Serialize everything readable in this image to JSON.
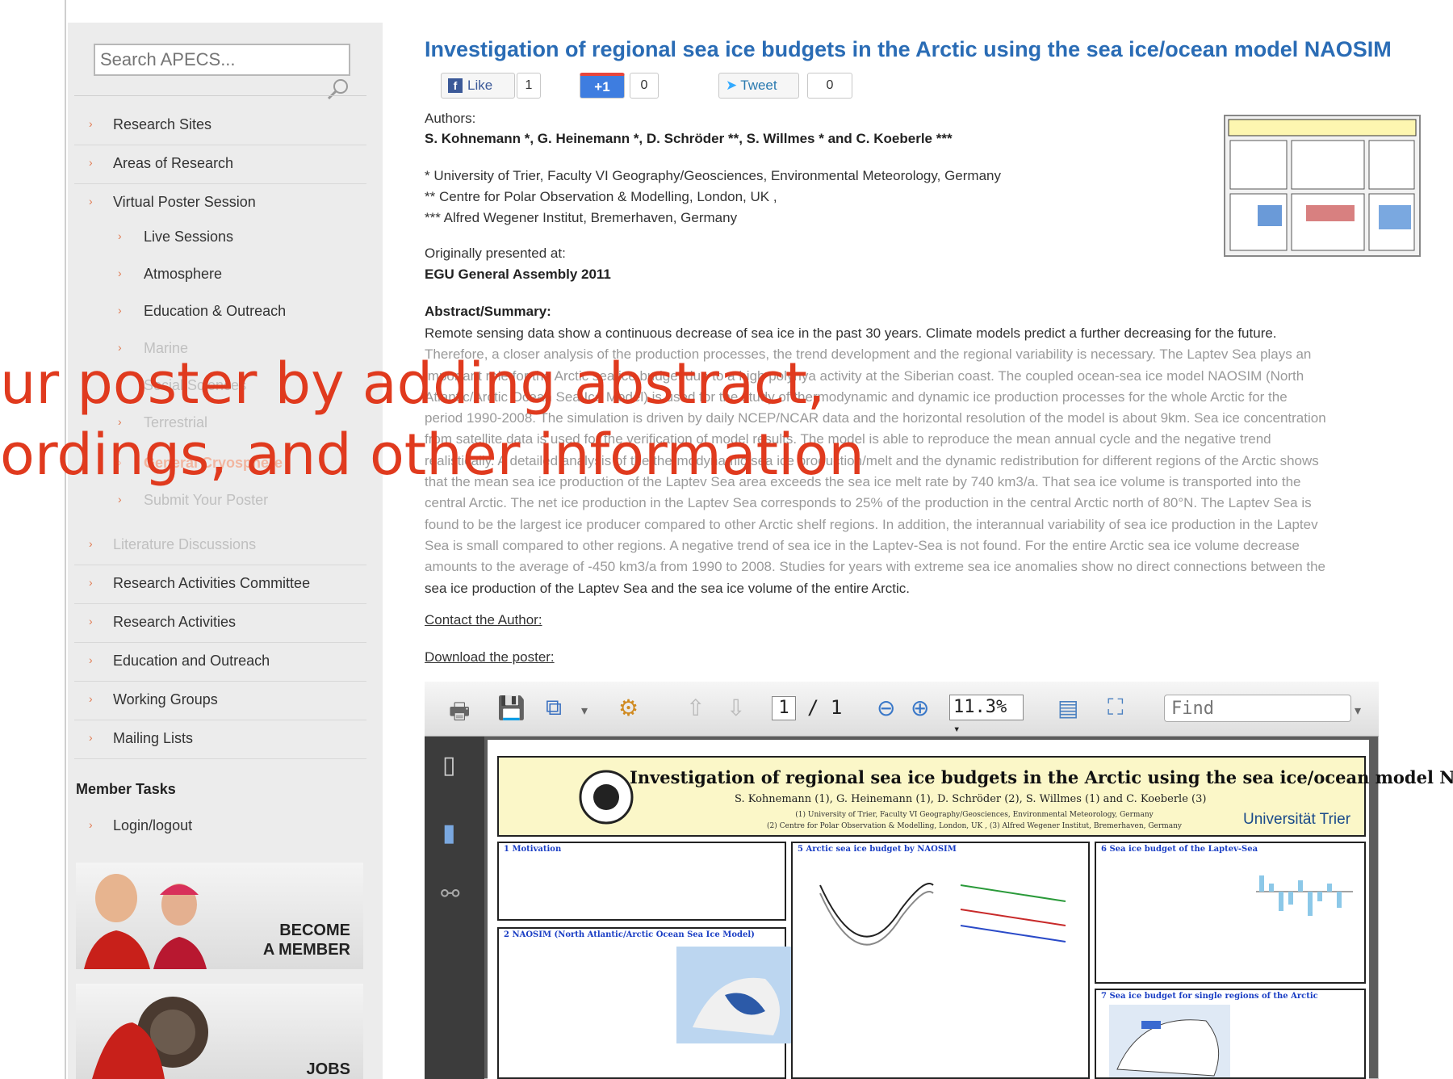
{
  "search": {
    "placeholder": "Search APECS..."
  },
  "sidebar": {
    "items": [
      {
        "label": "Research Sites"
      },
      {
        "label": "Areas of Research"
      },
      {
        "label": "Virtual Poster Session"
      }
    ],
    "subitems": [
      {
        "label": "Live Sessions"
      },
      {
        "label": "Atmosphere"
      },
      {
        "label": "Education & Outreach"
      },
      {
        "label": "Marine"
      },
      {
        "label": "Social Sciences"
      },
      {
        "label": "Terrestrial"
      },
      {
        "label": "General Cryosphere"
      },
      {
        "label": "Submit Your Poster"
      }
    ],
    "items2": [
      {
        "label": "Literature Discussions"
      },
      {
        "label": "Research Activities Committee"
      },
      {
        "label": "Research Activities"
      },
      {
        "label": "Education and Outreach"
      },
      {
        "label": "Working Groups"
      },
      {
        "label": "Mailing Lists"
      }
    ],
    "member_tasks": "Member Tasks",
    "login": "Login/logout",
    "become_member_line1": "BECOME",
    "become_member_line2": "A MEMBER",
    "jobs": "JOBS"
  },
  "article": {
    "title": "Investigation of regional sea ice budgets in the Arctic using the sea ice/ocean model NAOSIM",
    "social": {
      "like_label": "Like",
      "like_count": "1",
      "plus_label": "+1",
      "plus_count": "0",
      "tweet_label": "Tweet",
      "tweet_count": "0"
    },
    "authors_label": "Authors:",
    "authors": "S. Kohnemann *, G. Heinemann *, D. Schröder **, S. Willmes * and C. Koeberle ***",
    "affiliations": [
      "* University of Trier, Faculty VI Geography/Geosciences, Environmental Meteorology, Germany",
      "** Centre for Polar Observation & Modelling, London, UK ,",
      "*** Alfred Wegener Institut, Bremerhaven, Germany"
    ],
    "presented_label": "Originally presented at:",
    "presented_at": "EGU General Assembly 2011",
    "abstract_label": "Abstract/Summary:",
    "abstract_lines": [
      "Remote sensing data show a continuous decrease of sea ice in the past 30 years. Climate models predict a further decreasing for the future.",
      "Therefore, a closer analysis of the production processes, the trend development and the regional variability is necessary. The Laptev Sea plays an",
      "important role for the Arctic sea ice budget due to a high polynya activity at the Siberian coast. The coupled ocean-sea ice model NAOSIM (North",
      "Atlantic/Arctic Ocean Sea Ice Model) is used for the study of thermodynamic and dynamic ice production processes for the whole Arctic for the",
      "period 1990-2008. The simulation is driven by daily NCEP/NCAR data and the horizontal resolution of the model is about 9km. Sea ice concentration",
      "from satellite data is used for the verification of model results. The model is able to reproduce the mean annual cycle and the negative trend",
      "realistically. A detailed analysis of the thermodynamic sea ice production/melt and the dynamic redistribution for different regions of the Arctic shows",
      "that the mean sea ice production of the Laptev Sea area exceeds the sea ice melt rate by 740 km3/a. That sea ice volume is transported into the",
      "central Arctic. The net ice production in the Laptev Sea corresponds to 25% of the production in the central Arctic north of 80°N. The Laptev Sea is",
      "found to be the largest ice producer compared to other Arctic shelf regions. In addition, the interannual variability of sea ice production in the Laptev",
      "Sea is small compared to other regions. A negative trend of sea ice in the Laptev-Sea is not found. For the entire Arctic sea ice volume decrease",
      "amounts to the average of -450 km3/a from 1990 to 2008. Studies for years with extreme sea ice anomalies show no direct connections between the",
      "sea ice production of the Laptev Sea and the sea ice volume of the entire Arctic."
    ],
    "contact": "Contact the Author:",
    "download": "Download the poster:"
  },
  "viewer": {
    "page": "1",
    "page_total": "/ 1",
    "zoom": "11.3%",
    "find_placeholder": "Find"
  },
  "poster": {
    "title": "Investigation of regional sea ice budgets in the Arctic using the sea ice/ocean model NAOSIM",
    "authors": "S. Kohnemann (1), G. Heinemann (1), D. Schröder (2), S. Willmes (1) and C. Koeberle (3)",
    "aff1": "(1) University of Trier, Faculty VI Geography/Geosciences, Environmental Meteorology, Germany",
    "aff2": "(2) Centre for Polar Observation & Modelling, London, UK , (3) Alfred Wegener Institut, Bremerhaven, Germany",
    "university": "Universität Trier",
    "sections": [
      {
        "title": "1 Motivation"
      },
      {
        "title": "5 Arctic sea ice budget by NAOSIM"
      },
      {
        "title": "6 Sea ice budget of the Laptev-Sea"
      },
      {
        "title": "2 NAOSIM (North Atlantic/Arctic Ocean Sea Ice Model)"
      },
      {
        "title": "7 Sea ice budget for single regions of the Arctic"
      }
    ]
  },
  "overlay": {
    "line1": "ur poster by adding abstract,",
    "line2": "ordings, and other information"
  }
}
